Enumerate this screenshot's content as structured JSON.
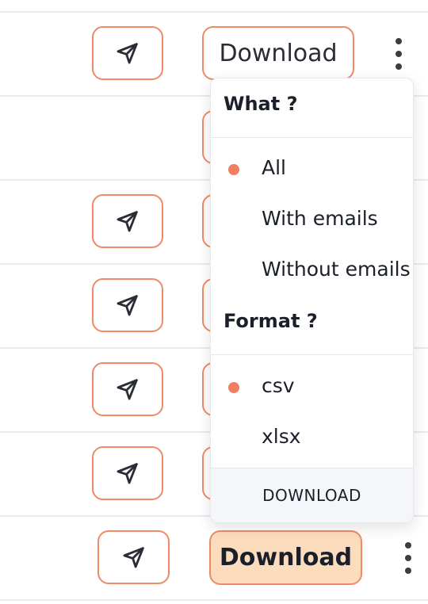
{
  "rows": {
    "top_download_label": "Download",
    "bottom_download_label": "Download"
  },
  "icons": {
    "send": "send-icon",
    "more": "more-vertical-icon"
  },
  "colors": {
    "accent": "#ef8a66",
    "accent_dot": "#ef7f5e",
    "download_fill": "#fbdcbc",
    "divider": "#e8eaf0",
    "menu_footer_bg": "#f5f6fa"
  },
  "download_menu": {
    "what_heading": "What ?",
    "what_options": [
      {
        "label": "All",
        "selected": true
      },
      {
        "label": "With emails",
        "selected": false
      },
      {
        "label": "Without emails",
        "selected": false
      }
    ],
    "format_heading": "Format ?",
    "format_options": [
      {
        "label": "csv",
        "selected": true
      },
      {
        "label": "xlsx",
        "selected": false
      }
    ],
    "action_label": "DOWNLOAD"
  }
}
